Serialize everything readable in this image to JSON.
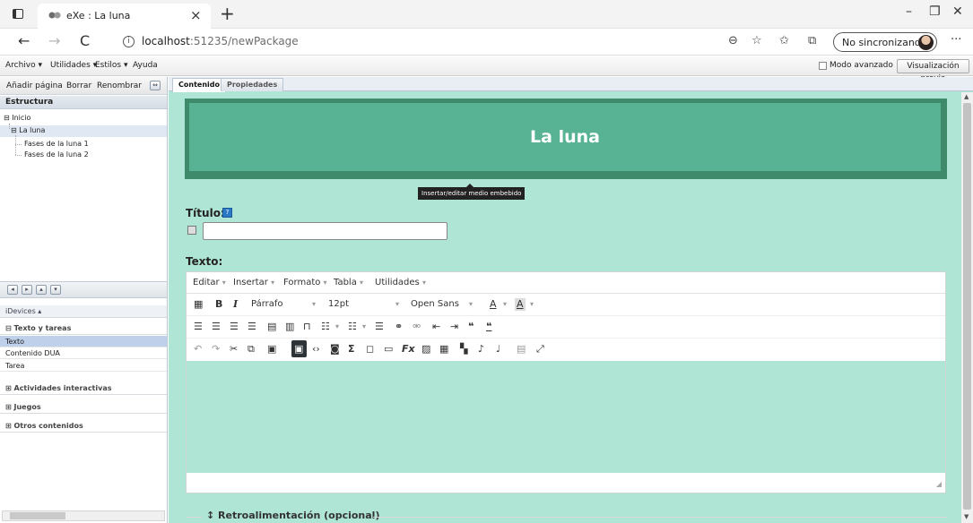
{
  "browser": {
    "tab_title": "eXe : La luna",
    "new_tab": "+",
    "close_tab": "×",
    "url_host": "localhost",
    "url_path": ":51235/newPackage",
    "sync_label": "No sincronizando",
    "more": "···",
    "win_minimize": "–",
    "win_restore": "❐",
    "win_close": "✕",
    "back": "←",
    "forward": "→",
    "reload": "C",
    "info": "i"
  },
  "app_menu": {
    "items": [
      "Archivo ▾",
      "Utilidades ▾",
      "Estilos ▾",
      "Ayuda"
    ],
    "advanced_mode": "Modo avanzado",
    "preview": "Visualización previa"
  },
  "left_panel": {
    "toolbar": [
      "Añadir página",
      "Borrar",
      "Renombrar"
    ],
    "structure_title": "Estructura",
    "tree": {
      "root": "Inicio",
      "child": "La luna",
      "grandchildren": [
        "Fases de la luna 1",
        "Fases de la luna 2"
      ]
    },
    "idevices_label": "iDevices",
    "categories": {
      "texto_tareas": "Texto y tareas",
      "actividades": "Actividades interactivas",
      "juegos": "Juegos",
      "otros": "Otros contenidos"
    },
    "idevices": [
      "Texto",
      "Contenido DUA",
      "Tarea"
    ]
  },
  "right_panel": {
    "tabs": [
      "Contenido",
      "Propiedades"
    ],
    "banner_title": "La luna",
    "title_label": "Título:",
    "text_label": "Texto:",
    "editor_menus": [
      "Editar",
      "Insertar",
      "Formato",
      "Tabla",
      "Utilidades"
    ],
    "paragraph_format": "Párrafo",
    "font_size": "12pt",
    "font_family": "Open Sans",
    "tooltip": "Insertar/editar medio embebido",
    "feedback_label": "Retroalimentación (opcional)"
  },
  "colors": {
    "content_bg": "#afe5d4",
    "banner_dark": "#3f8a6b",
    "banner_light": "#57b393"
  }
}
